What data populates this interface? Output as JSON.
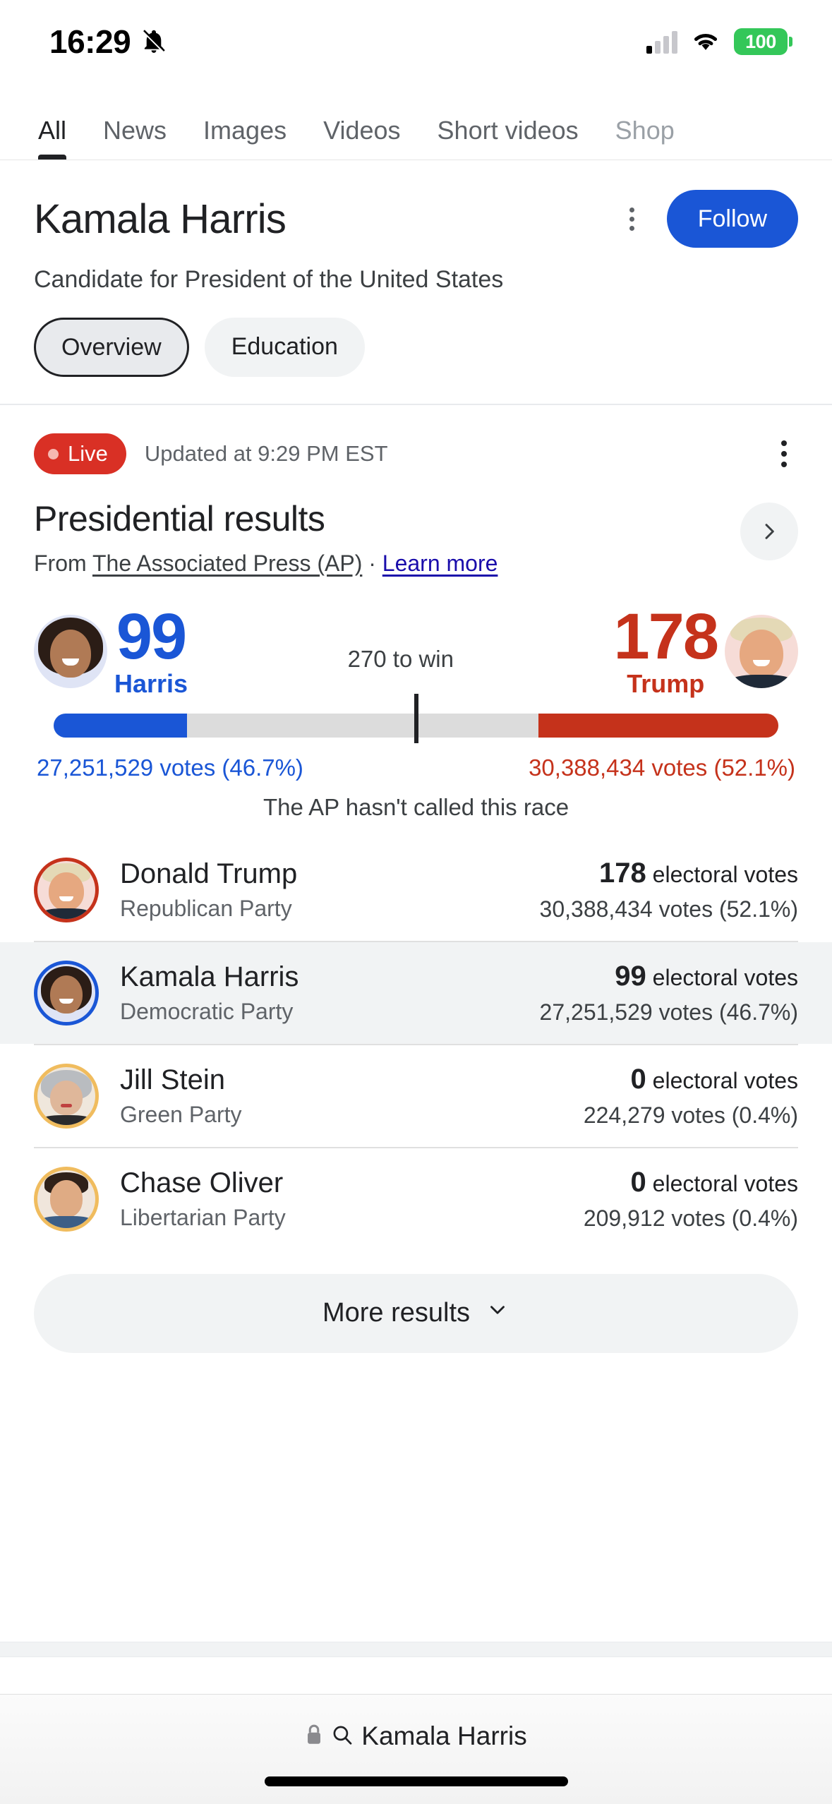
{
  "status_bar": {
    "time": "16:29",
    "mute_icon": "bell-off-icon",
    "signal_icon": "cellular-signal-icon",
    "wifi_icon": "wifi-icon",
    "battery_level": "100"
  },
  "tabs": [
    {
      "label": "All",
      "active": true
    },
    {
      "label": "News",
      "active": false
    },
    {
      "label": "Images",
      "active": false
    },
    {
      "label": "Videos",
      "active": false
    },
    {
      "label": "Short videos",
      "active": false
    },
    {
      "label": "Shop",
      "active": false
    }
  ],
  "entity": {
    "title": "Kamala Harris",
    "subtitle": "Candidate for President of the United States",
    "follow_label": "Follow",
    "more_icon": "kebab-menu-icon",
    "chips": [
      {
        "label": "Overview",
        "selected": true
      },
      {
        "label": "Education",
        "selected": false
      }
    ]
  },
  "results_card": {
    "live_label": "Live",
    "updated_text": "Updated at 9:29 PM EST",
    "overflow_icon": "kebab-menu-icon",
    "title": "Presidential results",
    "source_prefix": "From ",
    "source_name": "The Associated Press (AP)",
    "source_separator": " · ",
    "learn_more": "Learn more",
    "expand_icon": "chevron-right-icon",
    "threshold_label": "270 to win",
    "not_called_text": "The AP hasn't called this race",
    "more_results_label": "More results",
    "more_results_icon": "chevron-down-icon"
  },
  "chart_data": {
    "type": "bar",
    "title": "Presidential results",
    "subtitle": "From The Associated Press (AP)",
    "xlabel": "",
    "ylabel": "Electoral votes",
    "total_electoral_votes": 538,
    "threshold": 270,
    "threshold_label": "270 to win",
    "categories": [
      "Harris",
      "Trump"
    ],
    "series": [
      {
        "name": "Electoral votes",
        "values": [
          99,
          178
        ]
      },
      {
        "name": "Popular votes",
        "values": [
          27251529,
          30388434
        ]
      },
      {
        "name": "Popular vote share (%)",
        "values": [
          46.7,
          52.1
        ]
      }
    ],
    "colors": {
      "harris": "#1a56d6",
      "trump": "#c5321b",
      "remaining": "#dcdcdc"
    },
    "annotations": [
      "The AP hasn't called this race"
    ]
  },
  "scoreboard": {
    "left": {
      "name": "Harris",
      "electoral": "99",
      "votes_text": "27,251,529 votes (46.7%)",
      "color": "#1a56d6",
      "avatar": "kamala-harris-avatar"
    },
    "right": {
      "name": "Trump",
      "electoral": "178",
      "votes_text": "30,388,434 votes (52.1%)",
      "color": "#c5321b",
      "avatar": "donald-trump-avatar"
    }
  },
  "candidates": [
    {
      "name": "Donald Trump",
      "party": "Republican Party",
      "electoral": "178",
      "electoral_suffix": " electoral votes",
      "votes": "30,388,434 votes (52.1%)",
      "ring": "#c5321b",
      "highlighted": false,
      "avatar": "donald-trump-avatar"
    },
    {
      "name": "Kamala Harris",
      "party": "Democratic Party",
      "electoral": "99",
      "electoral_suffix": " electoral votes",
      "votes": "27,251,529 votes (46.7%)",
      "ring": "#1a56d6",
      "highlighted": true,
      "avatar": "kamala-harris-avatar"
    },
    {
      "name": "Jill Stein",
      "party": "Green Party",
      "electoral": "0",
      "electoral_suffix": " electoral votes",
      "votes": "224,279 votes (0.4%)",
      "ring": "#f0bc5e",
      "highlighted": false,
      "avatar": "jill-stein-avatar"
    },
    {
      "name": "Chase Oliver",
      "party": "Libertarian Party",
      "electoral": "0",
      "electoral_suffix": " electoral votes",
      "votes": "209,912 votes (0.4%)",
      "ring": "#f0bc5e",
      "highlighted": false,
      "avatar": "chase-oliver-avatar"
    }
  ],
  "bottom_bar": {
    "lock_icon": "lock-icon",
    "search_icon": "search-icon",
    "query": "Kamala Harris"
  }
}
